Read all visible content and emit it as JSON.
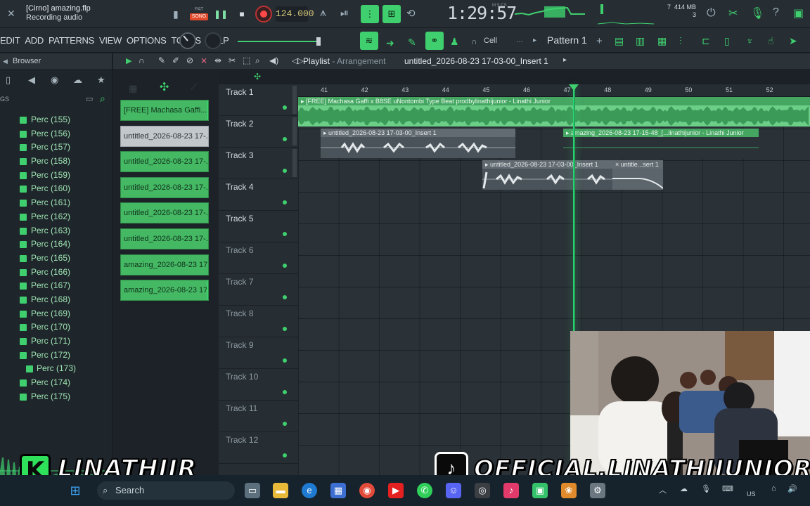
{
  "topbar": {
    "project_file": "[Cirno] amazing.flp",
    "status": "Recording audio",
    "pat_label": "PAT",
    "song_label": "SONG",
    "tempo": "124.000",
    "time": "1:29:57",
    "time_unit": "M:S:CS",
    "cpu_num": "7",
    "memory": "414 MB",
    "poly": "3"
  },
  "menubar": {
    "items": [
      "EDIT",
      "ADD",
      "PATTERNS",
      "VIEW",
      "OPTIONS",
      "TOOLS",
      "HELP"
    ],
    "cell_label": "Cell",
    "pattern": "Pattern 1"
  },
  "browser": {
    "title": "Browser",
    "tag_label": "GS",
    "items": [
      {
        "label": "Perc (155)",
        "indent": false
      },
      {
        "label": "Perc (156)",
        "indent": false
      },
      {
        "label": "Perc (157)",
        "indent": false
      },
      {
        "label": "Perc (158)",
        "indent": false
      },
      {
        "label": "Perc (159)",
        "indent": false
      },
      {
        "label": "Perc (160)",
        "indent": false
      },
      {
        "label": "Perc (161)",
        "indent": false
      },
      {
        "label": "Perc (162)",
        "indent": false
      },
      {
        "label": "Perc (163)",
        "indent": false
      },
      {
        "label": "Perc (164)",
        "indent": false
      },
      {
        "label": "Perc (165)",
        "indent": false
      },
      {
        "label": "Perc (166)",
        "indent": false
      },
      {
        "label": "Perc (167)",
        "indent": false
      },
      {
        "label": "Perc (168)",
        "indent": false
      },
      {
        "label": "Perc (169)",
        "indent": false
      },
      {
        "label": "Perc (170)",
        "indent": false
      },
      {
        "label": "Perc (171)",
        "indent": false
      },
      {
        "label": "Perc (172)",
        "indent": false
      },
      {
        "label": "Perc (173)",
        "indent": true
      },
      {
        "label": "Perc (174)",
        "indent": false
      },
      {
        "label": "Perc (175)",
        "indent": false
      }
    ]
  },
  "clip_list": [
    {
      "label": "[FREE] Machasa Gaffi...",
      "selected": false,
      "active": true
    },
    {
      "label": "untitled_2026-08-23 17-...",
      "selected": true,
      "active": false
    },
    {
      "label": "untitled_2026-08-23 17-...",
      "selected": false,
      "active": false
    },
    {
      "label": "untitled_2026-08-23 17-...",
      "selected": false,
      "active": false
    },
    {
      "label": "untitled_2026-08-23 17-...",
      "selected": false,
      "active": false
    },
    {
      "label": "untitled_2026-08-23 17-...",
      "selected": false,
      "active": false
    },
    {
      "label": "amazing_2026-08-23 17...",
      "selected": false,
      "active": false
    },
    {
      "label": "amazing_2026-08-23 17...",
      "selected": false,
      "active": true
    }
  ],
  "playlist": {
    "title": "Playlist",
    "subtitle": "Arrangement",
    "file": "untitled_2026-08-23 17-03-00_Insert 1",
    "bars": [
      "41",
      "42",
      "43",
      "44",
      "45",
      "46",
      "47",
      "48",
      "49",
      "50",
      "51",
      "52"
    ],
    "tracks": [
      "Track 1",
      "Track 2",
      "Track 3",
      "Track 4",
      "Track 5",
      "Track 6",
      "Track 7",
      "Track 8",
      "Track 9",
      "Track 10",
      "Track 11",
      "Track 12"
    ],
    "clips": {
      "beat": "[FREE] Machasa Gaffi x B8SE uNontombi Type Beat  prodbylinathijunior - Linathi Junior",
      "t2a": "untitled_2026-08-23 17-03-00_Insert 1",
      "t2b": "amazing_2026-08-23 17-15-48_[...linathijunior - Linathi Junior",
      "t3a": "untitled_2026-08-23 17-03-00_Insert 1",
      "t3b": "untitle...sert 1"
    }
  },
  "overlay": {
    "brand_left": "LINATHIJR",
    "brand_left_logo": "K",
    "brand_right": "OFFICIAL.LINATHIJUNIOR"
  },
  "taskbar": {
    "search_placeholder": "Search",
    "lang": "US"
  },
  "colors": {
    "accent_green": "#3fcf6e",
    "record_red": "#ff4848",
    "panel": "#262d33"
  }
}
